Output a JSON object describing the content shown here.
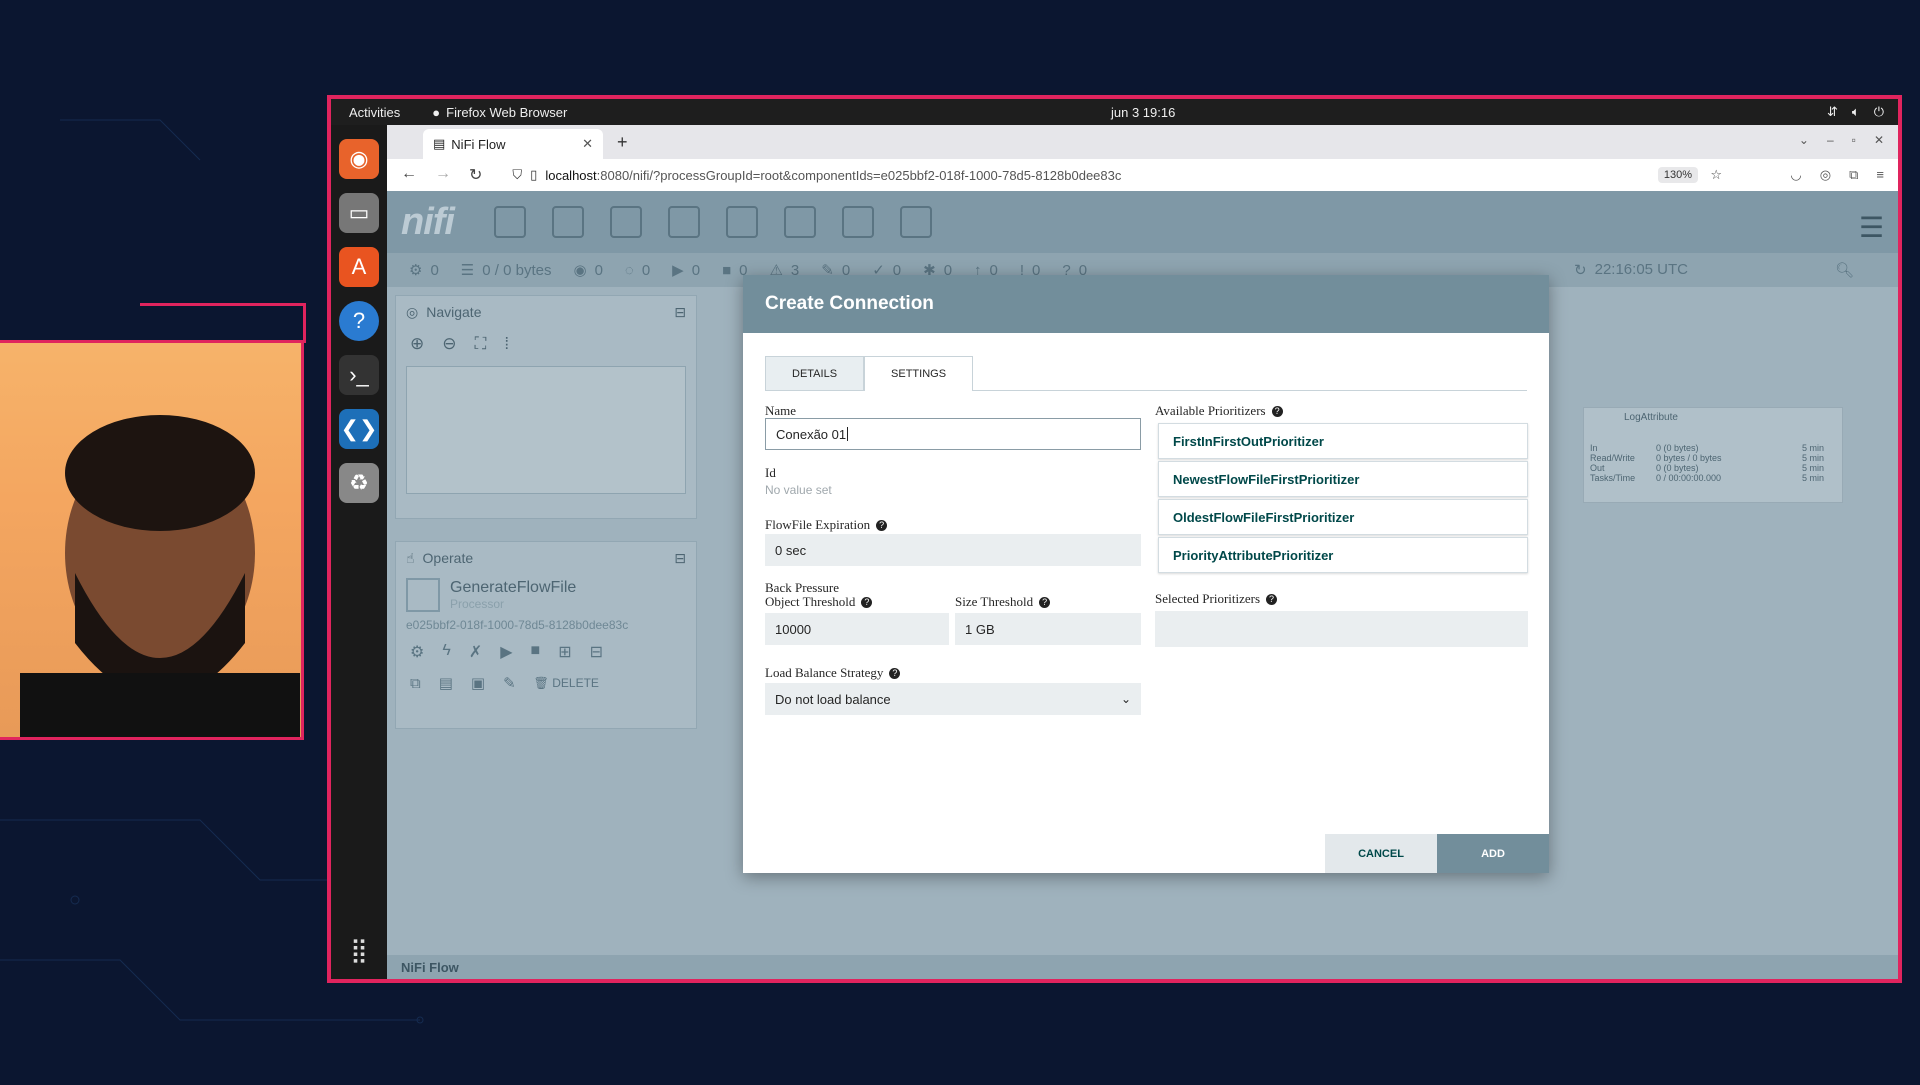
{
  "os": {
    "activities": "Activities",
    "app_name": "Firefox Web Browser",
    "clock": "jun 3  19:16"
  },
  "browser": {
    "tab_title": "NiFi Flow",
    "url_host": "localhost",
    "url_path": ":8080/nifi/?processGroupId=root&componentIds=e025bbf2-018f-1000-78d5-8128b0dee83c",
    "zoom": "130%"
  },
  "nifi": {
    "status": {
      "threads": "0",
      "queued": "0 / 0 bytes",
      "s2": "0",
      "s3": "0",
      "s4": "0",
      "s5": "0",
      "invalid": "3",
      "s7": "0",
      "s8": "0",
      "s9": "0",
      "s10": "0",
      "s11": "0",
      "s12": "0",
      "time": "22:16:05 UTC"
    },
    "navigate": {
      "title": "Navigate"
    },
    "operate": {
      "title": "Operate",
      "component_name": "GenerateFlowFile",
      "component_type": "Processor",
      "component_id": "e025bbf2-018f-1000-78d5-8128b0dee83c",
      "delete_label": "DELETE"
    },
    "processor_box": {
      "name": "LogAttribute",
      "rows": [
        {
          "k": "In",
          "v": "0 (0 bytes)",
          "t": "5 min"
        },
        {
          "k": "Read/Write",
          "v": "0 bytes / 0 bytes",
          "t": "5 min"
        },
        {
          "k": "Out",
          "v": "0 (0 bytes)",
          "t": "5 min"
        },
        {
          "k": "Tasks/Time",
          "v": "0 / 00:00:00.000",
          "t": "5 min"
        }
      ]
    },
    "footer": "NiFi Flow"
  },
  "dialog": {
    "title": "Create Connection",
    "tabs": [
      "DETAILS",
      "SETTINGS"
    ],
    "name_label": "Name",
    "name_value": "Conexão 01",
    "id_label": "Id",
    "id_value": "No value set",
    "expiration_label": "FlowFile Expiration",
    "expiration_value": "0 sec",
    "back_pressure_label": "Back Pressure",
    "object_threshold_label": "Object Threshold",
    "object_threshold_value": "10000",
    "size_threshold_label": "Size Threshold",
    "size_threshold_value": "1 GB",
    "load_balance_label": "Load Balance Strategy",
    "load_balance_value": "Do not load balance",
    "available_label": "Available Prioritizers",
    "prioritizers": [
      "FirstInFirstOutPrioritizer",
      "NewestFlowFileFirstPrioritizer",
      "OldestFlowFileFirstPrioritizer",
      "PriorityAttributePrioritizer"
    ],
    "selected_label": "Selected Prioritizers",
    "cancel": "CANCEL",
    "add": "ADD"
  }
}
